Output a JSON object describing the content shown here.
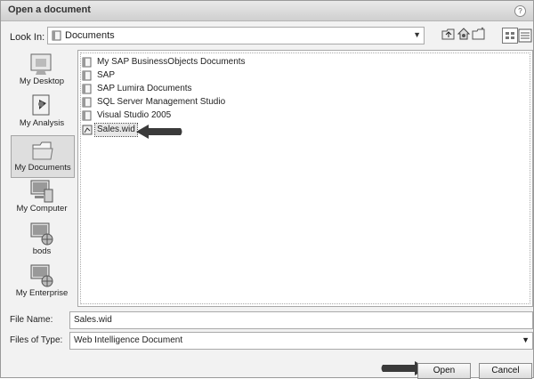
{
  "dialog": {
    "title": "Open a document",
    "help_glyph": "?"
  },
  "look_in": {
    "label": "Look In:",
    "value": "Documents"
  },
  "places": [
    {
      "label": "My Desktop"
    },
    {
      "label": "My Analysis"
    },
    {
      "label": "My Documents",
      "selected": true
    },
    {
      "label": "My Computer"
    },
    {
      "label": "bods"
    },
    {
      "label": "My Enterprise"
    }
  ],
  "files": [
    {
      "name": "My SAP BusinessObjects Documents",
      "type": "folder"
    },
    {
      "name": "SAP",
      "type": "folder"
    },
    {
      "name": "SAP Lumira Documents",
      "type": "folder"
    },
    {
      "name": "SQL Server Management Studio",
      "type": "folder"
    },
    {
      "name": "Visual Studio 2005",
      "type": "folder"
    },
    {
      "name": "Sales.wid",
      "type": "document",
      "selected": true
    }
  ],
  "file_name": {
    "label": "File Name:",
    "value": "Sales.wid"
  },
  "file_type": {
    "label": "Files of Type:",
    "value": "Web Intelligence Document"
  },
  "buttons": {
    "open": "Open",
    "cancel": "Cancel"
  }
}
